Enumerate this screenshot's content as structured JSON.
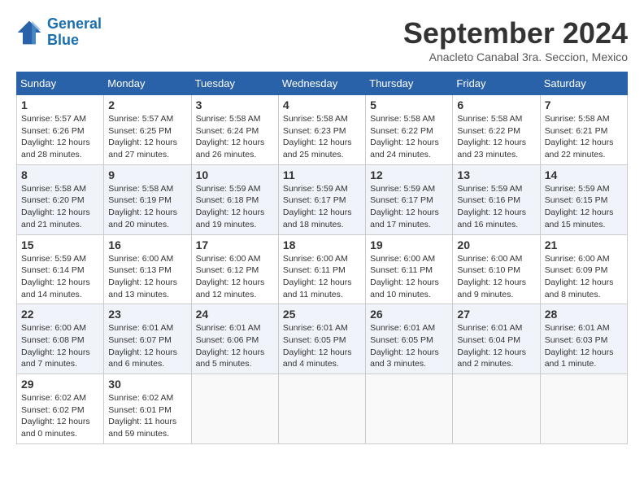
{
  "logo": {
    "line1": "General",
    "line2": "Blue"
  },
  "title": "September 2024",
  "location": "Anacleto Canabal 3ra. Seccion, Mexico",
  "weekdays": [
    "Sunday",
    "Monday",
    "Tuesday",
    "Wednesday",
    "Thursday",
    "Friday",
    "Saturday"
  ],
  "weeks": [
    [
      {
        "day": "1",
        "info": "Sunrise: 5:57 AM\nSunset: 6:26 PM\nDaylight: 12 hours\nand 28 minutes."
      },
      {
        "day": "2",
        "info": "Sunrise: 5:57 AM\nSunset: 6:25 PM\nDaylight: 12 hours\nand 27 minutes."
      },
      {
        "day": "3",
        "info": "Sunrise: 5:58 AM\nSunset: 6:24 PM\nDaylight: 12 hours\nand 26 minutes."
      },
      {
        "day": "4",
        "info": "Sunrise: 5:58 AM\nSunset: 6:23 PM\nDaylight: 12 hours\nand 25 minutes."
      },
      {
        "day": "5",
        "info": "Sunrise: 5:58 AM\nSunset: 6:22 PM\nDaylight: 12 hours\nand 24 minutes."
      },
      {
        "day": "6",
        "info": "Sunrise: 5:58 AM\nSunset: 6:22 PM\nDaylight: 12 hours\nand 23 minutes."
      },
      {
        "day": "7",
        "info": "Sunrise: 5:58 AM\nSunset: 6:21 PM\nDaylight: 12 hours\nand 22 minutes."
      }
    ],
    [
      {
        "day": "8",
        "info": "Sunrise: 5:58 AM\nSunset: 6:20 PM\nDaylight: 12 hours\nand 21 minutes."
      },
      {
        "day": "9",
        "info": "Sunrise: 5:58 AM\nSunset: 6:19 PM\nDaylight: 12 hours\nand 20 minutes."
      },
      {
        "day": "10",
        "info": "Sunrise: 5:59 AM\nSunset: 6:18 PM\nDaylight: 12 hours\nand 19 minutes."
      },
      {
        "day": "11",
        "info": "Sunrise: 5:59 AM\nSunset: 6:17 PM\nDaylight: 12 hours\nand 18 minutes."
      },
      {
        "day": "12",
        "info": "Sunrise: 5:59 AM\nSunset: 6:17 PM\nDaylight: 12 hours\nand 17 minutes."
      },
      {
        "day": "13",
        "info": "Sunrise: 5:59 AM\nSunset: 6:16 PM\nDaylight: 12 hours\nand 16 minutes."
      },
      {
        "day": "14",
        "info": "Sunrise: 5:59 AM\nSunset: 6:15 PM\nDaylight: 12 hours\nand 15 minutes."
      }
    ],
    [
      {
        "day": "15",
        "info": "Sunrise: 5:59 AM\nSunset: 6:14 PM\nDaylight: 12 hours\nand 14 minutes."
      },
      {
        "day": "16",
        "info": "Sunrise: 6:00 AM\nSunset: 6:13 PM\nDaylight: 12 hours\nand 13 minutes."
      },
      {
        "day": "17",
        "info": "Sunrise: 6:00 AM\nSunset: 6:12 PM\nDaylight: 12 hours\nand 12 minutes."
      },
      {
        "day": "18",
        "info": "Sunrise: 6:00 AM\nSunset: 6:11 PM\nDaylight: 12 hours\nand 11 minutes."
      },
      {
        "day": "19",
        "info": "Sunrise: 6:00 AM\nSunset: 6:11 PM\nDaylight: 12 hours\nand 10 minutes."
      },
      {
        "day": "20",
        "info": "Sunrise: 6:00 AM\nSunset: 6:10 PM\nDaylight: 12 hours\nand 9 minutes."
      },
      {
        "day": "21",
        "info": "Sunrise: 6:00 AM\nSunset: 6:09 PM\nDaylight: 12 hours\nand 8 minutes."
      }
    ],
    [
      {
        "day": "22",
        "info": "Sunrise: 6:00 AM\nSunset: 6:08 PM\nDaylight: 12 hours\nand 7 minutes."
      },
      {
        "day": "23",
        "info": "Sunrise: 6:01 AM\nSunset: 6:07 PM\nDaylight: 12 hours\nand 6 minutes."
      },
      {
        "day": "24",
        "info": "Sunrise: 6:01 AM\nSunset: 6:06 PM\nDaylight: 12 hours\nand 5 minutes."
      },
      {
        "day": "25",
        "info": "Sunrise: 6:01 AM\nSunset: 6:05 PM\nDaylight: 12 hours\nand 4 minutes."
      },
      {
        "day": "26",
        "info": "Sunrise: 6:01 AM\nSunset: 6:05 PM\nDaylight: 12 hours\nand 3 minutes."
      },
      {
        "day": "27",
        "info": "Sunrise: 6:01 AM\nSunset: 6:04 PM\nDaylight: 12 hours\nand 2 minutes."
      },
      {
        "day": "28",
        "info": "Sunrise: 6:01 AM\nSunset: 6:03 PM\nDaylight: 12 hours\nand 1 minute."
      }
    ],
    [
      {
        "day": "29",
        "info": "Sunrise: 6:02 AM\nSunset: 6:02 PM\nDaylight: 12 hours\nand 0 minutes."
      },
      {
        "day": "30",
        "info": "Sunrise: 6:02 AM\nSunset: 6:01 PM\nDaylight: 11 hours\nand 59 minutes."
      },
      {
        "day": "",
        "info": ""
      },
      {
        "day": "",
        "info": ""
      },
      {
        "day": "",
        "info": ""
      },
      {
        "day": "",
        "info": ""
      },
      {
        "day": "",
        "info": ""
      }
    ]
  ]
}
